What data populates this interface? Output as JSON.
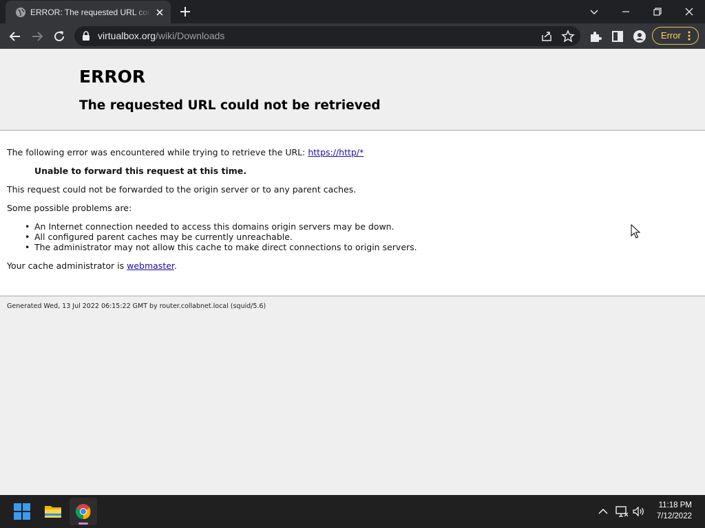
{
  "browser": {
    "tab_title": "ERROR: The requested URL could not be retrieved",
    "url_domain": "virtualbox.org",
    "url_path": "/wiki/Downloads",
    "error_pill_label": "Error"
  },
  "page": {
    "heading": "ERROR",
    "subheading": "The requested URL could not be retrieved",
    "intro_text": "The following error was encountered while trying to retrieve the URL: ",
    "intro_link": "https://http/*",
    "reason": "Unable to forward this request at this time.",
    "explanation": "This request could not be forwarded to the origin server or to any parent caches.",
    "problems_heading": "Some possible problems are:",
    "problems": [
      "An Internet connection needed to access this domains origin servers may be down.",
      "All configured parent caches may be currently unreachable.",
      "The administrator may not allow this cache to make direct connections to origin servers."
    ],
    "admin_text": "Your cache administrator is ",
    "admin_link": "webmaster",
    "admin_suffix": ".",
    "footer": "Generated Wed, 13 Jul 2022 06:15:22 GMT by router.collabnet.local (squid/5.6)"
  },
  "taskbar": {
    "time": "11:18 PM",
    "date": "7/12/2022",
    "apps": [
      "windows-start",
      "file-explorer",
      "google-chrome"
    ]
  },
  "colors": {
    "link": "#1a0dab",
    "error_pill": "#fdd663",
    "chrome_active_indicator": "#c88bd6"
  }
}
